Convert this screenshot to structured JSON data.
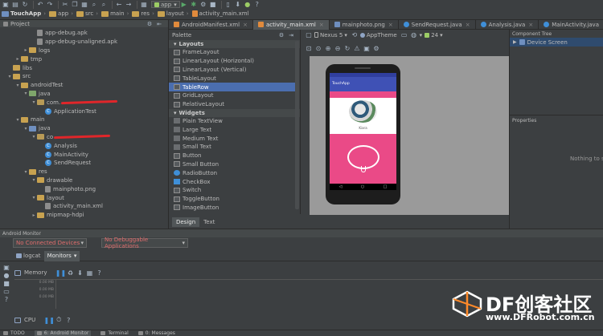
{
  "top_toolbar": {
    "crumbs": [
      "TouchApp",
      "app",
      "src",
      "main",
      "res",
      "layout",
      "activity_main.xml"
    ],
    "run_config": "app"
  },
  "project_panel": {
    "header": "Project",
    "tree": [
      {
        "label": "app-debug.apk",
        "indent": 5,
        "type": "file"
      },
      {
        "label": "app-debug-unaligned.apk",
        "indent": 5,
        "type": "file"
      },
      {
        "label": "logs",
        "indent": 4,
        "type": "folder"
      },
      {
        "label": "tmp",
        "indent": 3,
        "type": "folder"
      },
      {
        "label": "libs",
        "indent": 2,
        "type": "plain"
      },
      {
        "label": "src",
        "indent": 2,
        "type": "folder-open"
      },
      {
        "label": "androidTest",
        "indent": 3,
        "type": "folder-open"
      },
      {
        "label": "java",
        "indent": 4,
        "type": "folder-green"
      },
      {
        "label": "com.",
        "indent": 5,
        "type": "package",
        "redacted": true
      },
      {
        "label": "ApplicationTest",
        "indent": 6,
        "type": "class"
      },
      {
        "label": "main",
        "indent": 3,
        "type": "folder-open"
      },
      {
        "label": "java",
        "indent": 4,
        "type": "folder-blue"
      },
      {
        "label": "co",
        "indent": 5,
        "type": "package",
        "redacted": true
      },
      {
        "label": "Analysis",
        "indent": 6,
        "type": "class"
      },
      {
        "label": "MainActivity",
        "indent": 6,
        "type": "class"
      },
      {
        "label": "SendRequest",
        "indent": 6,
        "type": "class"
      },
      {
        "label": "res",
        "indent": 4,
        "type": "folder-open"
      },
      {
        "label": "drawable",
        "indent": 5,
        "type": "folder-open"
      },
      {
        "label": "mainphoto.png",
        "indent": 6,
        "type": "file"
      },
      {
        "label": "layout",
        "indent": 5,
        "type": "folder-open"
      },
      {
        "label": "activity_main.xml",
        "indent": 6,
        "type": "file"
      },
      {
        "label": "mipmap-hdpi",
        "indent": 5,
        "type": "folder"
      }
    ]
  },
  "editor_tabs": [
    {
      "label": "AndroidManifest.xml",
      "color": "#e08a3c",
      "active": false
    },
    {
      "label": "activity_main.xml",
      "color": "#e08a3c",
      "active": true
    },
    {
      "label": "mainphoto.png",
      "color": "#6f8fbf",
      "active": false
    },
    {
      "label": "SendRequest.java",
      "color": "#3f8fd8",
      "active": false
    },
    {
      "label": "Analysis.java",
      "color": "#3f8fd8",
      "active": false
    },
    {
      "label": "MainActivity.java",
      "color": "#3f8fd8",
      "active": false
    }
  ],
  "palette": {
    "header": "Palette",
    "groups": [
      {
        "title": "Layouts",
        "items": [
          "FrameLayout",
          "LinearLayout (Horizontal)",
          "LinearLayout (Vertical)",
          "TableLayout",
          "TableRow",
          "GridLayout",
          "RelativeLayout"
        ]
      },
      {
        "title": "Widgets",
        "items": [
          "Plain TextView",
          "Large Text",
          "Medium Text",
          "Small Text",
          "Button",
          "Small Button",
          "RadioButton",
          "CheckBox",
          "Switch",
          "ToggleButton",
          "ImageButton"
        ]
      }
    ],
    "selected": "TableRow"
  },
  "designer_toolbar": {
    "device": "Nexus 5",
    "theme": "AppTheme",
    "api": "24"
  },
  "phone": {
    "app_title": "TouchApp",
    "name_text": "Kiara",
    "accent": "#ea4a87",
    "bar_color": "#3f51b5"
  },
  "design_tabs": [
    "Design",
    "Text"
  ],
  "component_tree": {
    "header": "Component Tree",
    "root": "Device Screen"
  },
  "properties": {
    "header": "Properties",
    "empty": "Nothing to s"
  },
  "android_monitor": {
    "title": "Android Monitor",
    "device_select": "No Connected Devices",
    "app_select": "No Debuggable Applications",
    "tabs": [
      "logcat",
      "Monitors"
    ],
    "memory_label": "Memory",
    "memory_ticks": [
      "0.00 MB",
      "0.00 MB",
      "0.00 MB"
    ],
    "cpu_label": "CPU"
  },
  "bottom_bar": {
    "items": [
      "TODO",
      "6: Android Monitor",
      "Terminal",
      "0: Messages"
    ]
  },
  "watermark": {
    "brand": "DF创客社区",
    "url": "www.DFRobot.com.cn"
  }
}
